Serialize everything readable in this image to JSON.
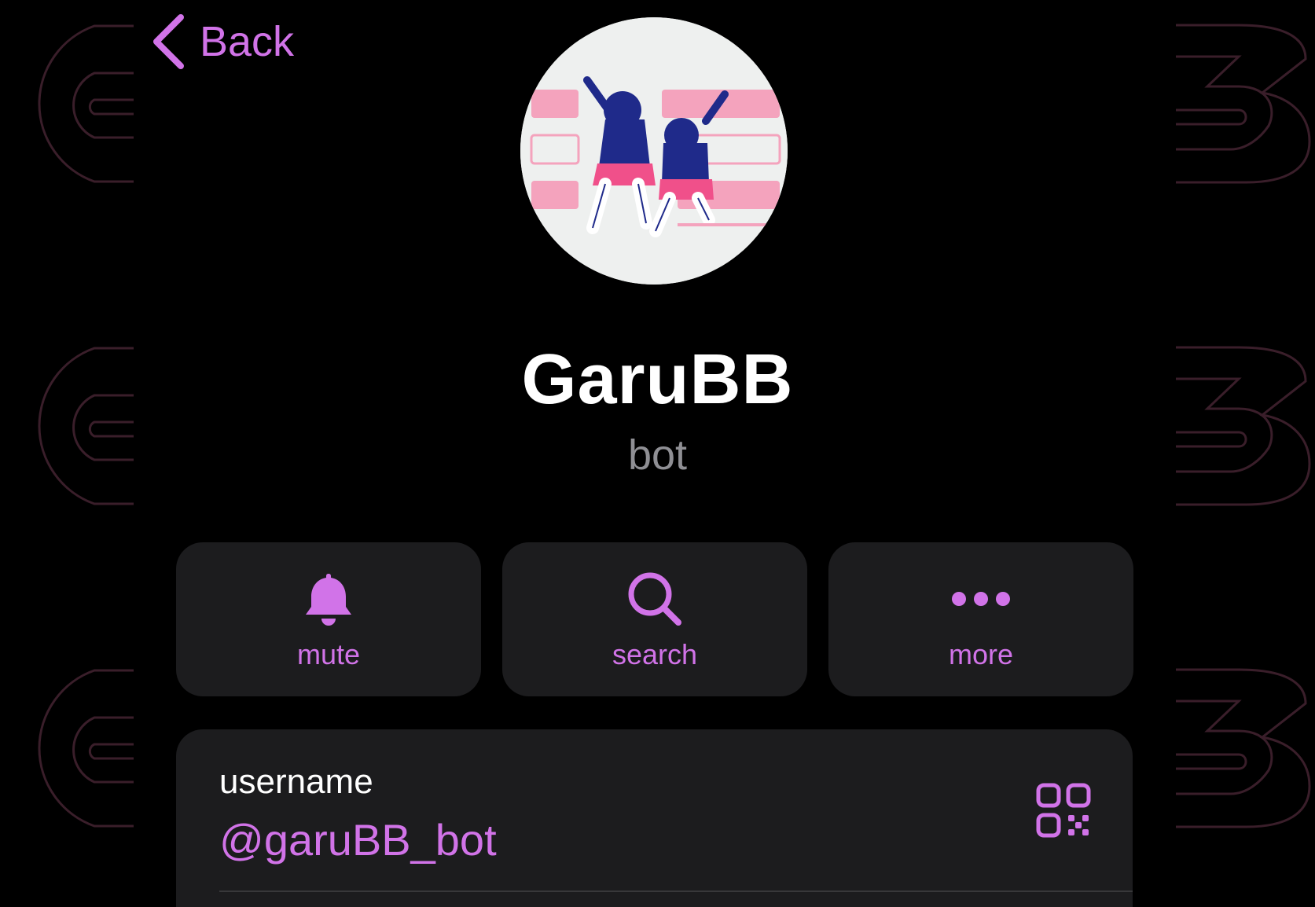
{
  "theme": {
    "accent": "#d173e8",
    "background": "#000000",
    "surface": "#1c1c1e",
    "muted": "#8f8f94",
    "deco_stroke": "#3a1e2a"
  },
  "nav": {
    "back_label": "Back",
    "back_icon": "chevron-left-icon"
  },
  "profile": {
    "name": "GaruBB",
    "subtitle": "bot"
  },
  "actions": [
    {
      "label": "mute",
      "icon": "bell-icon"
    },
    {
      "label": "search",
      "icon": "search-icon"
    },
    {
      "label": "more",
      "icon": "more-dots-icon"
    }
  ],
  "info": {
    "label": "username",
    "value": "@garuBB_bot",
    "qr_icon": "qr-code-icon"
  }
}
